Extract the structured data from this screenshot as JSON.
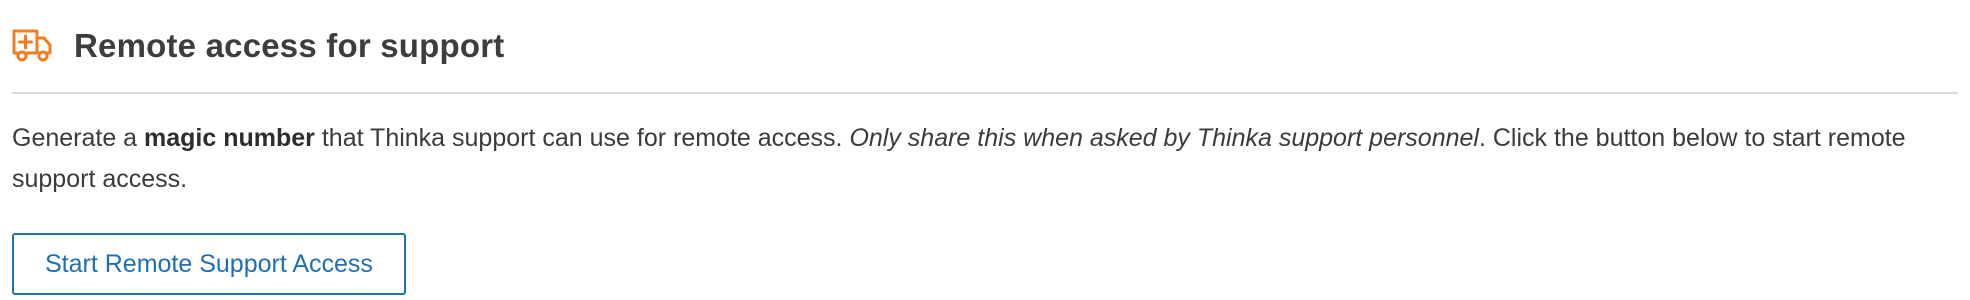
{
  "section": {
    "icon": "ambulance-icon",
    "title": "Remote access for support",
    "accent_color": "#f47c20"
  },
  "description": {
    "text_before": "Generate a ",
    "bold_text": "magic number",
    "text_middle": " that Thinka support can use for remote access. ",
    "italic_text": "Only share this when asked by Thinka support personnel",
    "text_after": ". Click the button below to start remote support access."
  },
  "button": {
    "label": "Start Remote Support Access",
    "color": "#1f6fb2"
  }
}
